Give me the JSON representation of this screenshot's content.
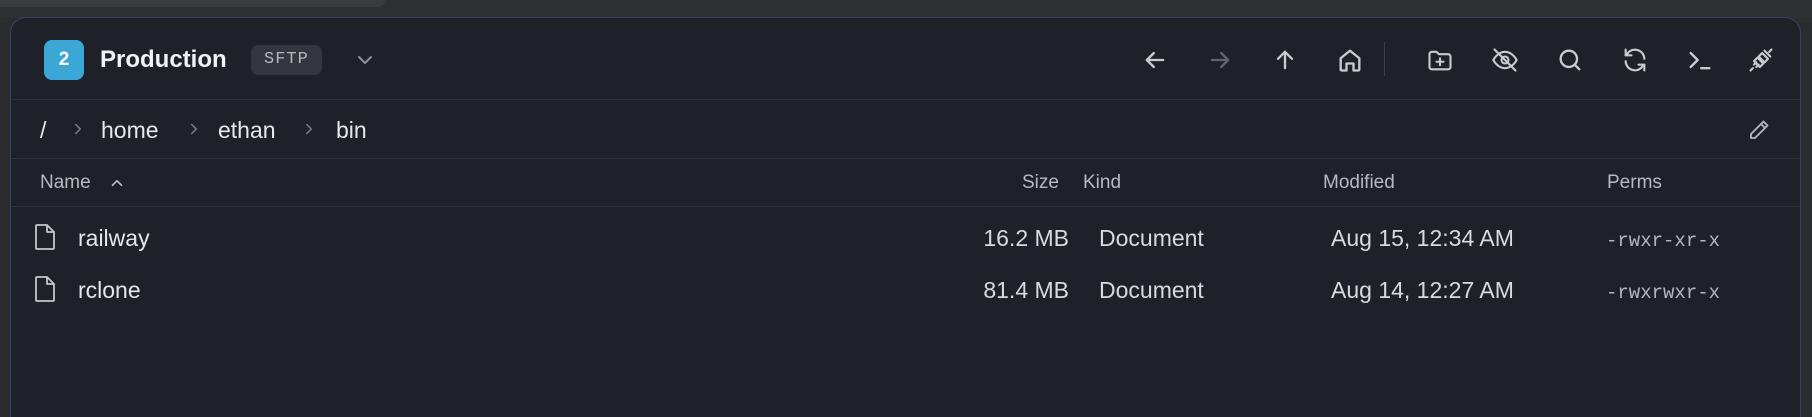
{
  "connection": {
    "badge_number": "2",
    "name": "Production",
    "protocol": "SFTP",
    "badge_color": "#3ba7d6"
  },
  "toolbar": {
    "icons": [
      "arrow-left-icon",
      "arrow-right-icon",
      "arrow-up-icon",
      "home-icon",
      "new-folder-icon",
      "hidden-files-icon",
      "search-icon",
      "refresh-icon",
      "terminal-icon",
      "disconnect-icon"
    ]
  },
  "path": {
    "root": "/",
    "segments": [
      "home",
      "ethan",
      "bin"
    ]
  },
  "table": {
    "columns": {
      "name": "Name",
      "size": "Size",
      "kind": "Kind",
      "modified": "Modified",
      "perms": "Perms"
    },
    "rows": [
      {
        "name": "railway",
        "size": "16.2 MB",
        "kind": "Document",
        "modified": "Aug 15, 12:34 AM",
        "perms": "-rwxr-xr-x"
      },
      {
        "name": "rclone",
        "size": "81.4 MB",
        "kind": "Document",
        "modified": "Aug 14, 12:27 AM",
        "perms": "-rwxrwxr-x"
      }
    ]
  }
}
